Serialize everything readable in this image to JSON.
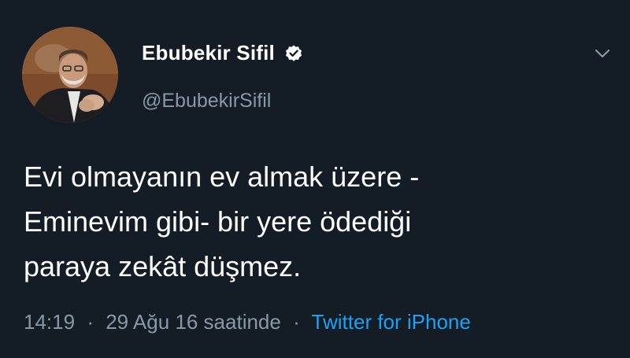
{
  "user": {
    "display_name": "Ebubekir Sifil",
    "handle": "@EbubekirSifil",
    "verified": true,
    "avatar": "profile-photo"
  },
  "tweet": {
    "lines": [
      "Evi olmayanın ev almak üzere -",
      "Eminevim gibi- bir yere ödediği",
      "paraya zekât düşmez."
    ]
  },
  "meta": {
    "time": "14:19",
    "date": "29 Ağu 16 saatinde",
    "separator": "·",
    "source": "Twitter for iPhone"
  },
  "icons": {
    "verified": "verified-badge-icon",
    "menu": "chevron-down-icon"
  },
  "colors": {
    "background": "#141d26",
    "primary_text": "#ffffff",
    "secondary_text": "#8899a6",
    "link": "#1da1f2"
  }
}
